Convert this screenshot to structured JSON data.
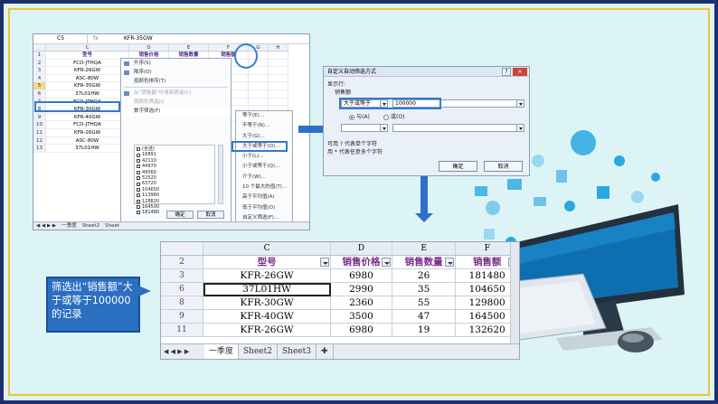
{
  "xl1": {
    "name_box": "C5",
    "formula_value": "KFR-35GW",
    "col_headers": [
      "C",
      "D",
      "E",
      "F",
      "G",
      "H"
    ],
    "header_row": {
      "c": "型号",
      "d": "销售价格",
      "e": "销售数量",
      "f": "销售额"
    },
    "rows": [
      {
        "n": "2",
        "c": "FCD-JTHQA"
      },
      {
        "n": "3",
        "c": "KFR-26GW"
      },
      {
        "n": "4",
        "c": "ASC-80W"
      },
      {
        "n": "5",
        "c": "KFR-35GW"
      },
      {
        "n": "6",
        "c": "37L01HW"
      },
      {
        "n": "7",
        "c": "FCD-JTHQA"
      },
      {
        "n": "8",
        "c": "KFR-30GW"
      },
      {
        "n": "9",
        "c": "KFR-40GW"
      },
      {
        "n": "10",
        "c": "FCD-JTHQA"
      },
      {
        "n": "11",
        "c": "KFR-26GW"
      },
      {
        "n": "12",
        "c": "ASC-80W"
      },
      {
        "n": "13",
        "c": "37L01HW"
      }
    ],
    "menu_items": [
      "升序(S)",
      "降序(O)",
      "按颜色排序(T)",
      "从“销售额”中清除筛选(C)",
      "按颜色筛选(I)",
      "数字筛选(F)"
    ],
    "list_items": [
      "(全选)",
      "16891",
      "42110",
      "44970",
      "49560",
      "52520",
      "63720",
      "104650",
      "113960",
      "128820",
      "164500",
      "181480"
    ],
    "ok_label": "确定",
    "cancel_label": "取消",
    "submenu_items": [
      "等于(E)...",
      "不等于(N)...",
      "大于(G)...",
      "大于或等于(O)...",
      "小于(L)...",
      "小于或等于(Q)...",
      "介于(W)...",
      "10 个最大的值(T)...",
      "高于平均值(A)",
      "低于平均值(O)",
      "自定义筛选(F)..."
    ],
    "tabs": [
      "一季度",
      "Sheet2",
      "Sheet"
    ]
  },
  "dialog": {
    "title": "自定义自动筛选方式",
    "show_rows": "显示行:",
    "field": "销售额",
    "op1": "大于或等于",
    "val1": "100000",
    "and_label": "与(A)",
    "or_label": "或(O)",
    "hint1": "可用 ? 代表单个字符",
    "hint2": "用 * 代表任意多个字符",
    "ok": "确定",
    "cancel": "取消"
  },
  "xl2": {
    "col_headers": [
      "C",
      "D",
      "E",
      "F"
    ],
    "header_row": {
      "n": "2",
      "c": "型号",
      "d": "销售价格",
      "e": "销售数量",
      "f": "销售额"
    },
    "rows": [
      {
        "n": "3",
        "c": "KFR-26GW",
        "d": "6980",
        "e": "26",
        "f": "181480"
      },
      {
        "n": "6",
        "c": "37L01HW",
        "d": "2990",
        "e": "35",
        "f": "104650"
      },
      {
        "n": "8",
        "c": "KFR-30GW",
        "d": "2360",
        "e": "55",
        "f": "129800"
      },
      {
        "n": "9",
        "c": "KFR-40GW",
        "d": "3500",
        "e": "47",
        "f": "164500"
      },
      {
        "n": "11",
        "c": "KFR-26GW",
        "d": "6980",
        "e": "19",
        "f": "132620"
      }
    ],
    "nav": "◀ ◀ ▶ ▶",
    "tabs": [
      "一季度",
      "Sheet2",
      "Sheet3"
    ]
  },
  "callout": {
    "text": "筛选出“销售额”大于或等于100000的记录"
  },
  "colors": {
    "accent": "#2f6fc9",
    "frame": "#1d2f6e",
    "frame_inner": "#f0c23a",
    "bg": "#ddf4f6"
  }
}
